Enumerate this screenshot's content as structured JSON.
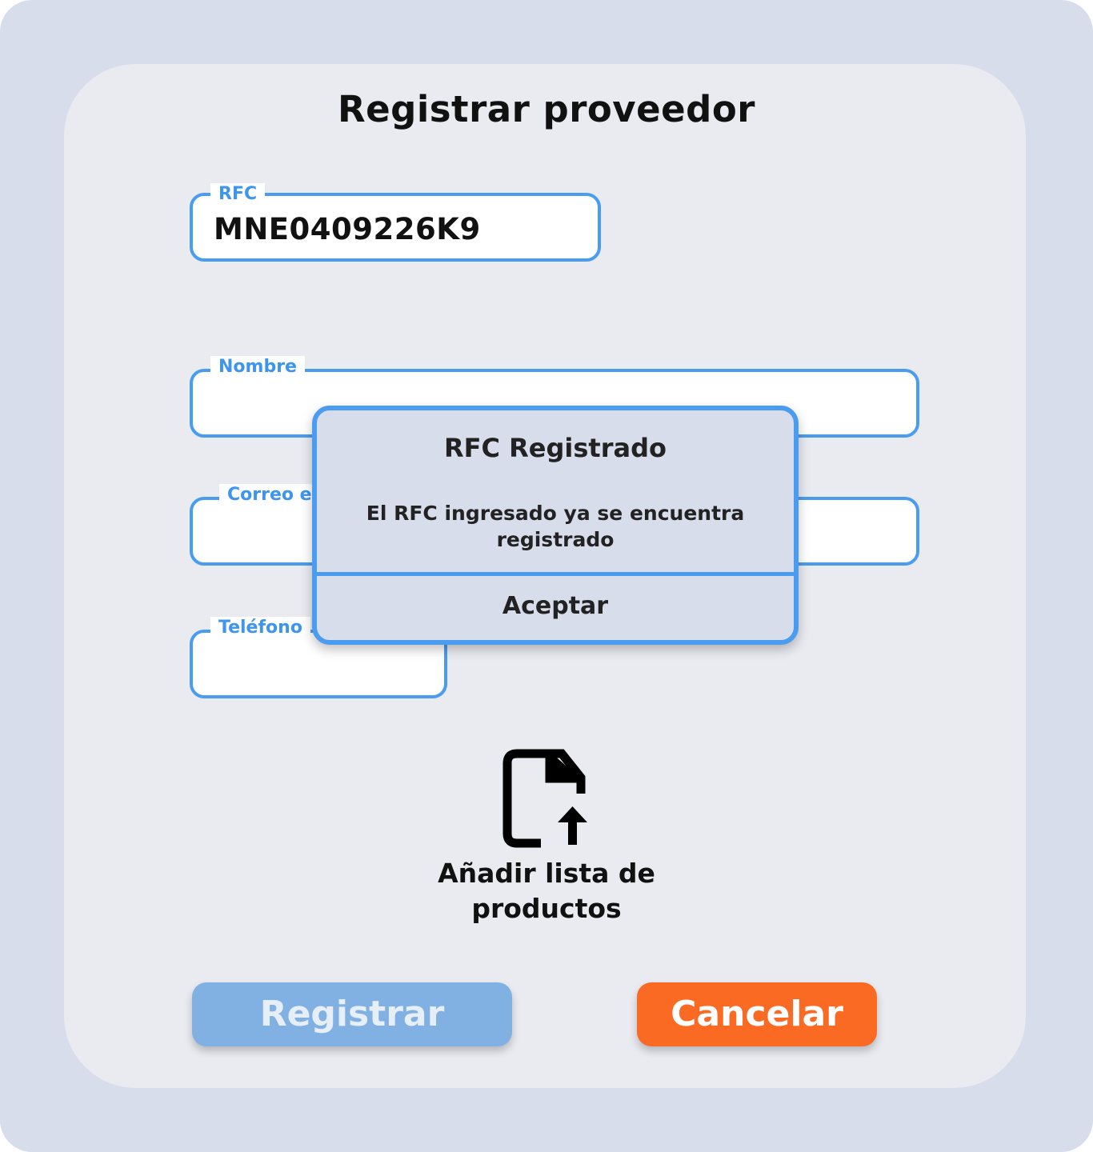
{
  "page": {
    "title": "Registrar proveedor"
  },
  "form": {
    "rfc": {
      "label": "RFC",
      "value": "MNE0409226K9"
    },
    "nombre": {
      "label": "Nombre",
      "value": ""
    },
    "correo": {
      "label": "Correo el",
      "value": ""
    },
    "telefono": {
      "label": "Teléfono",
      "value": ""
    }
  },
  "upload": {
    "icon": "file-upload-icon",
    "label_line1": "Añadir lista de",
    "label_line2": "productos"
  },
  "actions": {
    "register_label": "Registrar",
    "cancel_label": "Cancelar"
  },
  "dialog": {
    "title": "RFC Registrado",
    "message_line1": "El RFC ingresado ya se encuentra",
    "message_line2": "registrado",
    "button_label": "Aceptar"
  },
  "colors": {
    "accent": "#4a9cf0",
    "cancel": "#fb6a22",
    "register_disabled": "#80b1e2",
    "background": "#d7ddea"
  }
}
